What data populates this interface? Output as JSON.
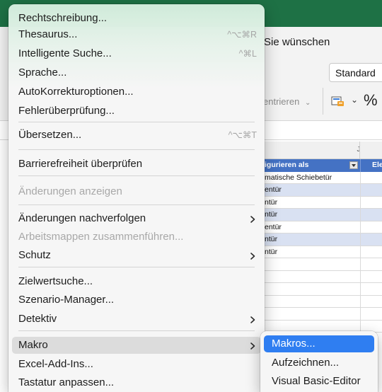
{
  "excel": {
    "tell_me": "Sie wünschen",
    "number_format": "Standard",
    "center_label": "entrieren",
    "percent_symbol": "%",
    "column_letter": "J",
    "table_rows": [
      {
        "c1": "igurieren als",
        "c2": "Elem",
        "kind": "header"
      },
      {
        "c1": "matische Schiebetür",
        "c2": "",
        "kind": "plain"
      },
      {
        "c1": "entür",
        "c2": "",
        "kind": "band"
      },
      {
        "c1": "ntür",
        "c2": "",
        "kind": "plain"
      },
      {
        "c1": "ntür",
        "c2": "",
        "kind": "band"
      },
      {
        "c1": "entür",
        "c2": "",
        "kind": "plain"
      },
      {
        "c1": "ntür",
        "c2": "",
        "kind": "band"
      },
      {
        "c1": "ntür",
        "c2": "",
        "kind": "plain"
      },
      {
        "c1": "",
        "c2": "",
        "kind": "plain"
      },
      {
        "c1": "",
        "c2": "",
        "kind": "plain"
      },
      {
        "c1": "",
        "c2": "",
        "kind": "plain"
      },
      {
        "c1": "",
        "c2": "",
        "kind": "plain"
      },
      {
        "c1": "",
        "c2": "",
        "kind": "plain"
      },
      {
        "c1": "",
        "c2": "",
        "kind": "plain"
      }
    ],
    "accent_green": "#1e7145",
    "table_header_blue": "#4472c4",
    "table_band_blue": "#d9e1f2"
  },
  "menu": {
    "items": [
      {
        "id": "rechtschreibung",
        "label": "Rechtschreibung...",
        "shortcut": "",
        "submenu": false,
        "disabled": false
      },
      {
        "id": "thesaurus",
        "label": "Thesaurus...",
        "shortcut": "^⌥⌘R",
        "submenu": false,
        "disabled": false
      },
      {
        "id": "intelligente-suche",
        "label": "Intelligente Suche...",
        "shortcut": "^⌘L",
        "submenu": false,
        "disabled": false
      },
      {
        "id": "sprache",
        "label": "Sprache...",
        "shortcut": "",
        "submenu": false,
        "disabled": false
      },
      {
        "id": "autokorrektur",
        "label": "AutoKorrekturoptionen...",
        "shortcut": "",
        "submenu": false,
        "disabled": false
      },
      {
        "id": "fehlerpruefung",
        "label": "Fehlerüberprüfung...",
        "shortcut": "",
        "submenu": false,
        "disabled": false
      },
      {
        "id": "uebersetzen",
        "label": "Übersetzen...",
        "shortcut": "^⌥⌘T",
        "submenu": false,
        "disabled": false
      },
      {
        "id": "barrierefreiheit",
        "label": "Barrierefreiheit überprüfen",
        "shortcut": "",
        "submenu": false,
        "disabled": false
      },
      {
        "id": "aenderungen-anzeigen",
        "label": "Änderungen anzeigen",
        "shortcut": "",
        "submenu": false,
        "disabled": true
      },
      {
        "id": "aenderungen-nachverfolgen",
        "label": "Änderungen nachverfolgen",
        "shortcut": "",
        "submenu": true,
        "disabled": false
      },
      {
        "id": "arbeitsmappen-zusammenfuehren",
        "label": "Arbeitsmappen zusammenführen...",
        "shortcut": "",
        "submenu": false,
        "disabled": true
      },
      {
        "id": "schutz",
        "label": "Schutz",
        "shortcut": "",
        "submenu": true,
        "disabled": false
      },
      {
        "id": "zielwertsuche",
        "label": "Zielwertsuche...",
        "shortcut": "",
        "submenu": false,
        "disabled": false
      },
      {
        "id": "szenario-manager",
        "label": "Szenario-Manager...",
        "shortcut": "",
        "submenu": false,
        "disabled": false
      },
      {
        "id": "detektiv",
        "label": "Detektiv",
        "shortcut": "",
        "submenu": true,
        "disabled": false
      },
      {
        "id": "makro",
        "label": "Makro",
        "shortcut": "",
        "submenu": true,
        "disabled": false,
        "highlighted": true
      },
      {
        "id": "excel-add-ins",
        "label": "Excel-Add-Ins...",
        "shortcut": "",
        "submenu": false,
        "disabled": false
      },
      {
        "id": "tastatur-anpassen",
        "label": "Tastatur anpassen...",
        "shortcut": "",
        "submenu": false,
        "disabled": false
      }
    ]
  },
  "submenu": {
    "items": [
      {
        "id": "makros",
        "label": "Makros...",
        "selected": true
      },
      {
        "id": "aufzeichnen",
        "label": "Aufzeichnen...",
        "selected": false
      },
      {
        "id": "vba-editor",
        "label": "Visual Basic-Editor",
        "selected": false
      }
    ],
    "selection_color": "#2f7ef1"
  }
}
